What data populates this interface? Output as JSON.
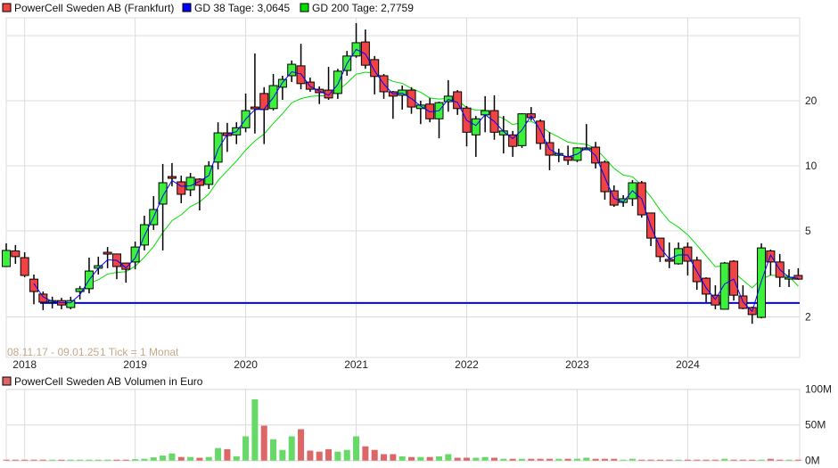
{
  "legend": {
    "price_label": "PowerCell Sweden AB (Frankfurt)",
    "gd38_label": "GD 38 Tage: 3,0645",
    "gd200_label": "GD 200 Tage: 2,7759",
    "volume_label": "PowerCell Sweden AB Volumen in Euro"
  },
  "range_label": "08.11.17 - 09.01.25",
  "tick_label": "1 Tick = 1 Monat",
  "colors": {
    "up": "#3cf03c",
    "down": "#f04444",
    "gd38": "#0000ff",
    "gd200": "#00e000",
    "vol_up": "#66d966",
    "vol_down": "#dd6666",
    "hline": "#0000ff"
  },
  "chart_data": {
    "type": "candlestick",
    "title": "PowerCell Sweden AB (Frankfurt)",
    "interval": "1 Monat",
    "start": "11.2017",
    "y_scale": "log",
    "y_ticks": [
      "20",
      "10",
      "5",
      "2"
    ],
    "x_ticks": [
      "2018",
      "2019",
      "2020",
      "2021",
      "2022",
      "2023",
      "2024"
    ],
    "support_line": 2.32,
    "gd38_last": 3.0645,
    "gd200_last": 2.7759,
    "ohlc": [
      [
        3.42,
        4.38,
        3.4,
        4.06
      ],
      [
        4.04,
        4.3,
        3.52,
        3.8
      ],
      [
        3.76,
        3.98,
        3.05,
        3.11
      ],
      [
        2.99,
        3.14,
        2.29,
        2.62
      ],
      [
        2.55,
        2.62,
        2.15,
        2.34
      ],
      [
        2.34,
        2.48,
        2.19,
        2.38
      ],
      [
        2.38,
        2.45,
        2.17,
        2.27
      ],
      [
        2.21,
        2.48,
        2.17,
        2.38
      ],
      [
        2.62,
        2.78,
        2.41,
        2.7
      ],
      [
        2.7,
        3.76,
        2.57,
        3.26
      ],
      [
        3.36,
        3.8,
        3.14,
        3.45
      ],
      [
        3.98,
        4.21,
        3.36,
        3.91
      ],
      [
        3.91,
        3.91,
        2.99,
        3.42
      ],
      [
        3.55,
        3.55,
        2.88,
        3.32
      ],
      [
        3.59,
        4.46,
        3.32,
        4.21
      ],
      [
        4.3,
        5.88,
        4.06,
        5.34
      ],
      [
        5.34,
        7.24,
        5.05,
        6.28
      ],
      [
        6.65,
        10.2,
        4.06,
        8.35
      ],
      [
        8.92,
        10.3,
        8.04,
        8.76
      ],
      [
        8.43,
        9.01,
        6.71,
        7.38
      ],
      [
        7.74,
        9.27,
        7.24,
        8.84
      ],
      [
        8.68,
        8.76,
        6.22,
        8.12
      ],
      [
        8.2,
        10.5,
        7.81,
        10.0
      ],
      [
        10.4,
        15.9,
        9.63,
        14.2
      ],
      [
        14.2,
        15.8,
        11.6,
        13.8
      ],
      [
        13.9,
        15.9,
        12.6,
        15.0
      ],
      [
        15.0,
        21.6,
        14.3,
        18.0
      ],
      [
        18.7,
        33.1,
        14.1,
        18.4
      ],
      [
        21.6,
        23.1,
        12.6,
        18.2
      ],
      [
        18.4,
        26.6,
        18.0,
        23.5
      ],
      [
        23.1,
        26.1,
        20.2,
        25.1
      ],
      [
        26.1,
        30.7,
        24.4,
        29.5
      ],
      [
        29.0,
        36.7,
        22.6,
        24.0
      ],
      [
        24.4,
        25.6,
        22.0,
        22.6
      ],
      [
        22.6,
        23.3,
        19.3,
        21.8
      ],
      [
        22.4,
        28.7,
        20.2,
        20.6
      ],
      [
        21.6,
        28.1,
        20.4,
        27.4
      ],
      [
        27.6,
        34.0,
        26.1,
        32.2
      ],
      [
        32.2,
        45.7,
        31.6,
        37.1
      ],
      [
        37.4,
        42.7,
        28.1,
        29.2
      ],
      [
        31.0,
        32.2,
        21.4,
        25.9
      ],
      [
        26.1,
        26.6,
        20.4,
        22.0
      ],
      [
        22.0,
        22.2,
        16.5,
        21.0
      ],
      [
        21.2,
        23.5,
        18.2,
        22.4
      ],
      [
        22.4,
        23.1,
        17.4,
        18.7
      ],
      [
        18.4,
        20.0,
        15.6,
        19.1
      ],
      [
        19.3,
        20.6,
        15.9,
        16.5
      ],
      [
        16.5,
        19.8,
        13.4,
        19.6
      ],
      [
        19.8,
        24.9,
        17.8,
        21.0
      ],
      [
        22.0,
        22.4,
        17.2,
        18.4
      ],
      [
        18.5,
        18.9,
        12.3,
        14.3
      ],
      [
        13.9,
        17.0,
        11.0,
        16.5
      ],
      [
        17.2,
        21.0,
        14.3,
        18.0
      ],
      [
        18.0,
        21.2,
        13.2,
        14.3
      ],
      [
        13.9,
        17.0,
        11.4,
        14.5
      ],
      [
        13.9,
        14.5,
        11.0,
        12.3
      ],
      [
        12.4,
        17.5,
        12.1,
        17.4
      ],
      [
        17.4,
        18.7,
        16.2,
        16.7
      ],
      [
        16.1,
        16.4,
        11.9,
        12.7
      ],
      [
        12.8,
        14.3,
        9.54,
        11.2
      ],
      [
        11.2,
        12.0,
        10.4,
        11.4
      ],
      [
        11.0,
        12.4,
        10.1,
        10.6
      ],
      [
        10.6,
        12.2,
        10.4,
        12.1
      ],
      [
        12.0,
        15.6,
        11.9,
        12.1
      ],
      [
        12.2,
        12.9,
        9.72,
        10.3
      ],
      [
        10.4,
        10.6,
        6.97,
        7.59
      ],
      [
        7.66,
        8.12,
        6.46,
        6.58
      ],
      [
        6.77,
        7.31,
        6.46,
        7.04
      ],
      [
        7.04,
        8.59,
        6.52,
        8.35
      ],
      [
        8.35,
        8.51,
        5.76,
        5.93
      ],
      [
        6.05,
        6.05,
        4.25,
        4.63
      ],
      [
        4.63,
        4.63,
        3.59,
        3.8
      ],
      [
        3.69,
        4.42,
        3.36,
        3.62
      ],
      [
        3.52,
        4.42,
        3.49,
        4.14
      ],
      [
        4.21,
        4.42,
        3.11,
        3.62
      ],
      [
        3.66,
        3.8,
        2.67,
        2.91
      ],
      [
        3.02,
        3.05,
        2.34,
        2.55
      ],
      [
        2.52,
        2.8,
        2.17,
        2.27
      ],
      [
        2.17,
        3.59,
        2.17,
        3.55
      ],
      [
        3.62,
        3.66,
        2.38,
        2.52
      ],
      [
        2.5,
        2.8,
        2.17,
        2.19
      ],
      [
        2.21,
        2.23,
        1.86,
        2.05
      ],
      [
        1.99,
        4.38,
        1.97,
        4.17
      ],
      [
        4.04,
        4.1,
        3.11,
        3.59
      ],
      [
        3.59,
        3.91,
        2.75,
        3.05
      ],
      [
        3.02,
        3.32,
        2.75,
        3.05
      ],
      [
        3.11,
        3.36,
        2.97,
        2.99
      ]
    ],
    "volume_unit": "M Euro",
    "volume_ticks": [
      "100M",
      "50M",
      "0M"
    ],
    "volume_range": [
      0,
      100
    ],
    "volume": [
      0.8,
      0.8,
      0.8,
      0.8,
      0.8,
      0.8,
      0.8,
      0.8,
      0.8,
      0.8,
      0.8,
      0.8,
      0.8,
      0.8,
      2,
      2.5,
      4.5,
      7,
      10,
      5,
      5,
      4,
      5,
      17.5,
      16,
      6,
      34,
      86,
      49,
      30,
      15,
      34,
      44,
      14,
      12.5,
      16,
      12.5,
      15,
      34,
      20,
      15,
      9,
      9,
      6,
      5,
      5,
      5,
      6,
      9,
      4,
      4,
      4,
      5,
      4,
      2.5,
      2.5,
      2.5,
      2.5,
      2.5,
      2.5,
      2.5,
      2.5,
      2.5,
      4,
      2.5,
      2.5,
      2.5,
      1.2,
      2.5,
      1.2,
      1.2,
      1.2,
      1.2,
      1.2,
      1.2,
      1.2,
      1.2,
      1.2,
      2.5,
      1.2,
      1.2,
      1.2,
      1.2,
      2.5,
      1.2,
      1.2,
      1.2
    ]
  }
}
